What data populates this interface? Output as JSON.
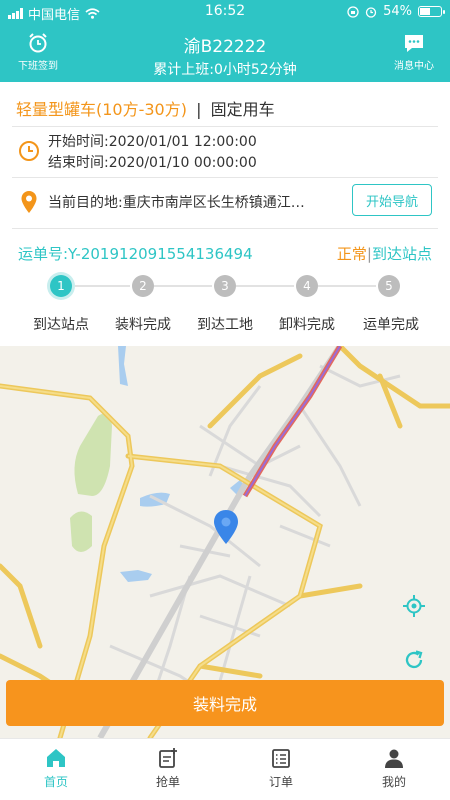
{
  "status_bar": {
    "carrier": "中国电信",
    "time": "16:52",
    "battery": "54%",
    "battery_level": 0.54
  },
  "header": {
    "left_label": "下班签到",
    "plate": "渝B22222",
    "work_time": "累计上班:0小时52分钟",
    "right_label": "消息中心"
  },
  "vehicle": {
    "type": "轻量型罐车(10方-30方)",
    "sep": "|",
    "usage": "固定用车"
  },
  "schedule": {
    "start": "开始时间:2020/01/01 12:00:00",
    "end": "结束时间:2020/01/10 00:00:00"
  },
  "destination": {
    "text": "当前目的地:重庆市南岸区长生桥镇通江…",
    "button": "开始导航"
  },
  "waybill": {
    "number": "运单号:Y-201912091554136494",
    "status_main": "正常",
    "status_sep": "|",
    "status_sub": "到达站点"
  },
  "steps": [
    {
      "num": "1",
      "label": "到达站点",
      "active": true
    },
    {
      "num": "2",
      "label": "装料完成",
      "active": false
    },
    {
      "num": "3",
      "label": "到达工地",
      "active": false
    },
    {
      "num": "4",
      "label": "卸料完成",
      "active": false
    },
    {
      "num": "5",
      "label": "运单完成",
      "active": false
    }
  ],
  "action_button": "装料完成",
  "tabs": [
    {
      "label": "首页",
      "icon": "home-icon",
      "active": true
    },
    {
      "label": "抢单",
      "icon": "grab-order-icon",
      "active": false
    },
    {
      "label": "订单",
      "icon": "order-list-icon",
      "active": false
    },
    {
      "label": "我的",
      "icon": "user-icon",
      "active": false
    }
  ],
  "colors": {
    "brand": "#2ec5c5",
    "accent": "#f7941d"
  }
}
